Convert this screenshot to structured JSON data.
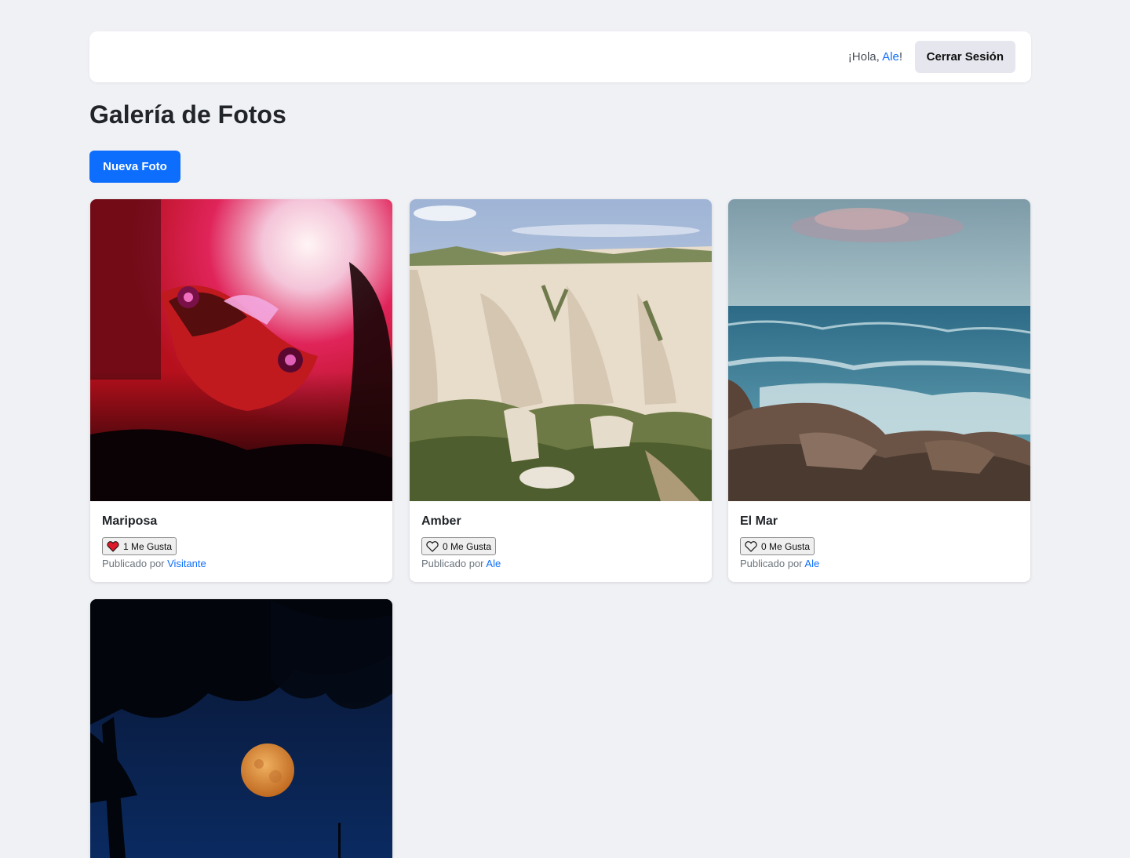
{
  "header": {
    "greeting_prefix": "¡Hola, ",
    "user": "Ale",
    "greeting_suffix": "!",
    "logout_label": "Cerrar Sesión"
  },
  "page": {
    "title": "Galería de Fotos",
    "new_photo_label": "Nueva Foto"
  },
  "photos": [
    {
      "title": "Mariposa",
      "likes_label": "1 Me Gusta",
      "liked": true,
      "posted_prefix": "Publicado por ",
      "author": "Visitante",
      "image": "butterfly-photo"
    },
    {
      "title": "Amber",
      "likes_label": "0 Me Gusta",
      "liked": false,
      "posted_prefix": "Publicado por ",
      "author": "Ale",
      "image": "badlands-photo"
    },
    {
      "title": "El Mar",
      "likes_label": "0 Me Gusta",
      "liked": false,
      "posted_prefix": "Publicado por ",
      "author": "Ale",
      "image": "sea-rocks-photo"
    },
    {
      "title": "",
      "image": "moon-night-photo"
    }
  ],
  "colors": {
    "background": "#f0f1f5",
    "primary": "#0d6efd",
    "heart": "#dc1a2a"
  }
}
